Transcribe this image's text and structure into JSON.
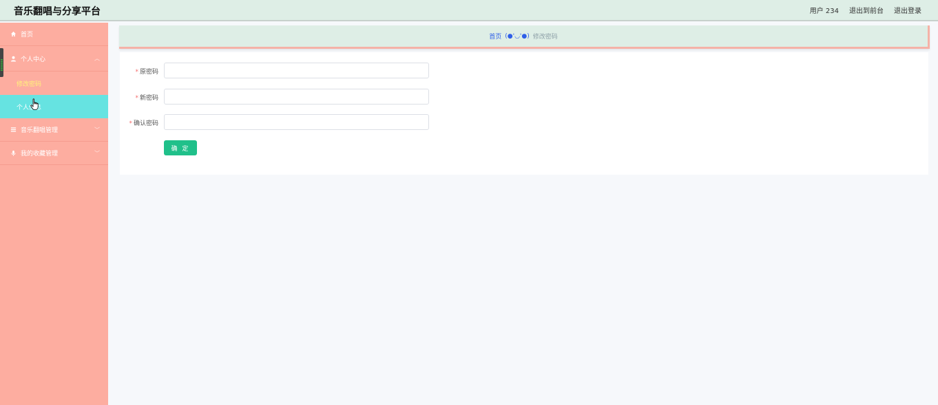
{
  "header": {
    "title": "音乐翻唱与分享平台",
    "user": "用户 234",
    "front_link": "退出到前台",
    "logout_link": "退出登录"
  },
  "sidebar": {
    "home": "首页",
    "personal_center": "个人中心",
    "change_password": "修改密码",
    "personal_info": "个人信息",
    "music_cover_mgmt": "音乐翻唱管理",
    "favorites_mgmt": "我的收藏管理"
  },
  "breadcrumb": {
    "home": "首页",
    "face": "(●'◡'●)",
    "current": "修改密码"
  },
  "form": {
    "old_password_label": "原密码",
    "new_password_label": "新密码",
    "confirm_password_label": "确认密码",
    "old_password_value": "",
    "new_password_value": "",
    "confirm_password_value": "",
    "submit": "确 定"
  },
  "colors": {
    "sidebar_bg": "#fdada0",
    "header_bg": "#deeee6",
    "selected_item": "#66e3e1",
    "submit_button": "#20c08a",
    "active_text": "#fff37a"
  }
}
